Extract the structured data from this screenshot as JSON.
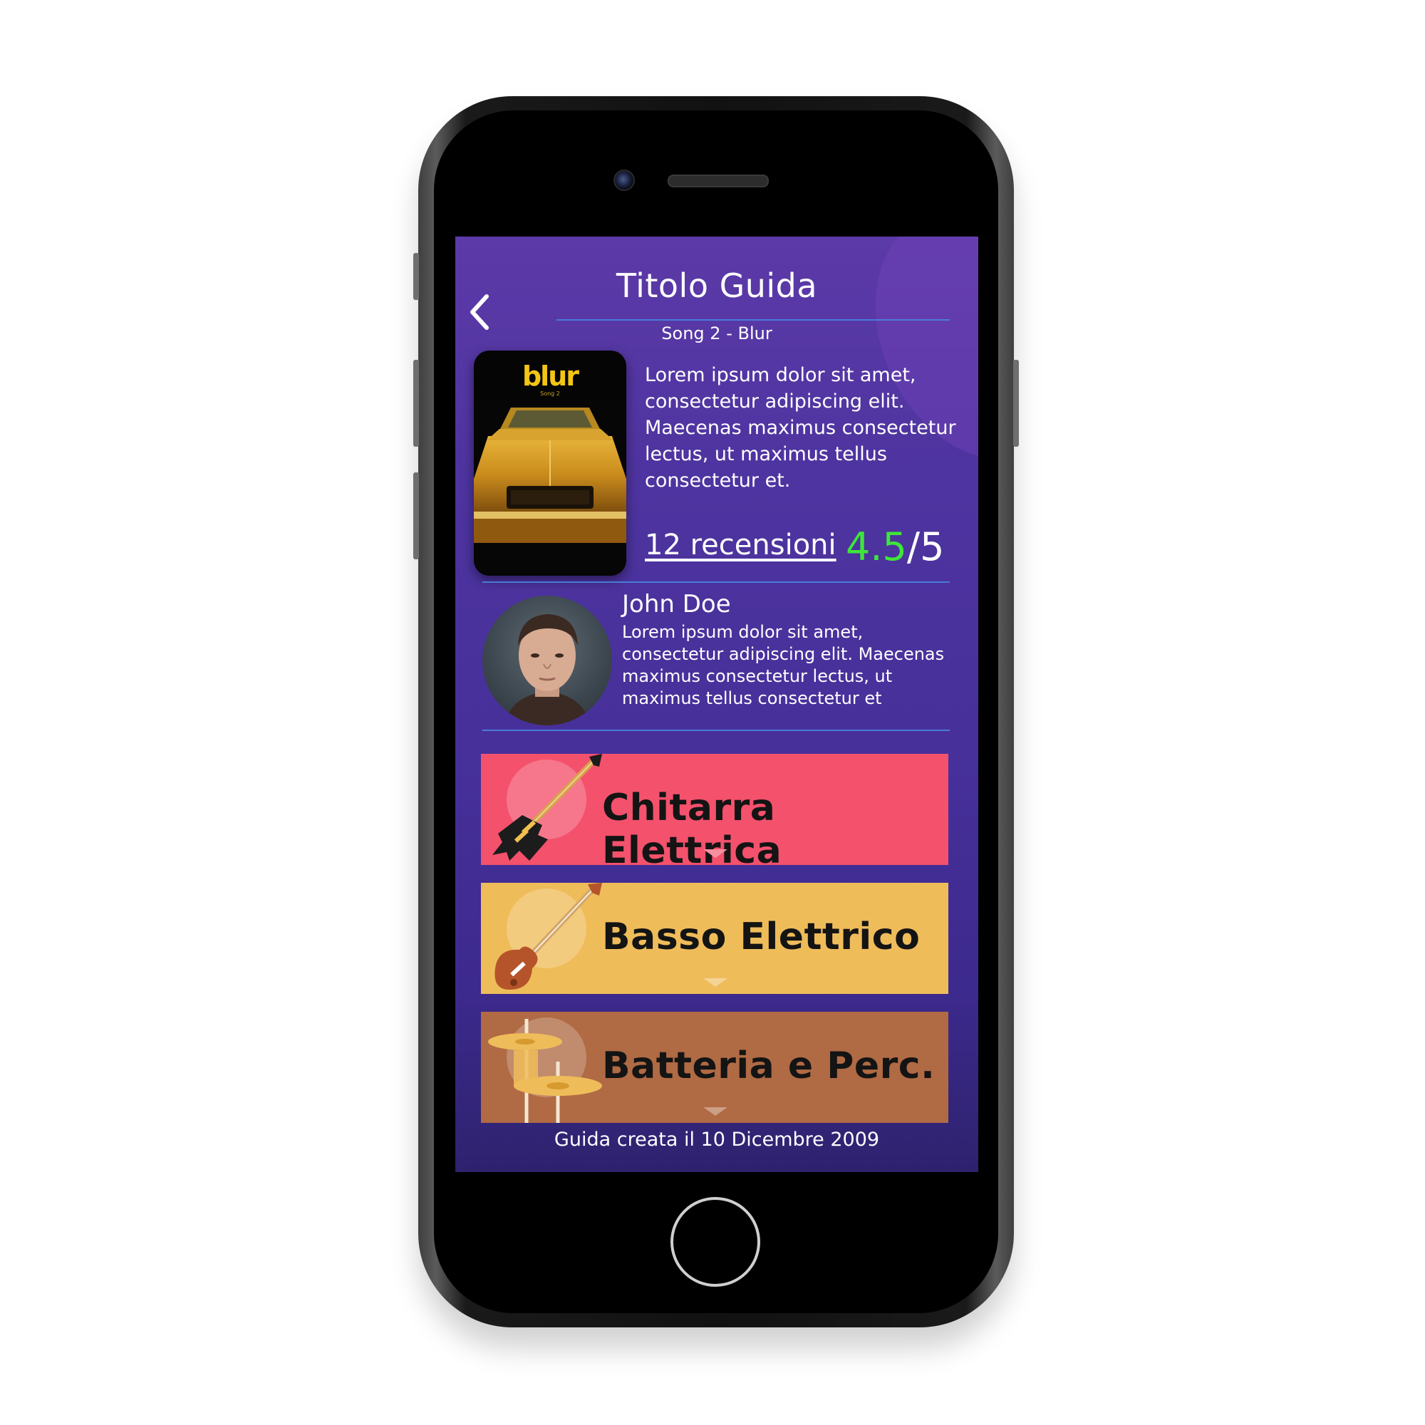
{
  "header": {
    "title": "Titolo Guida",
    "subtitle": "Song 2 - Blur"
  },
  "album": {
    "logo_text": "blur",
    "logo_subtext": "Song 2"
  },
  "description": "Lorem ipsum dolor sit amet, consectetur adipiscing elit. Maecenas maximus consectetur lectus, ut maximus tellus consectetur et.",
  "reviews": {
    "link_label": "12 recensioni",
    "rating_value": "4.5",
    "rating_max": "/5"
  },
  "author": {
    "name": "John Doe",
    "bio": "Lorem ipsum dolor sit amet, consectetur adipiscing elit. Maecenas maximus consectetur lectus, ut maximus tellus consectetur et"
  },
  "instruments": [
    {
      "label": "Chitarra Elettrica",
      "color": "#f4516c",
      "icon": "electric-guitar-icon"
    },
    {
      "label": "Basso Elettrico",
      "color": "#efbc5a",
      "icon": "bass-guitar-icon"
    },
    {
      "label": "Batteria e Perc.",
      "color": "#b06a44",
      "icon": "drums-cymbal-icon"
    }
  ],
  "footer": "Guida creata il 10 Dicembre 2009",
  "colors": {
    "background_top": "#5c3aa8",
    "background_bottom": "#2e226e",
    "divider": "#4a7bd8",
    "rating_accent": "#3ee63a"
  }
}
